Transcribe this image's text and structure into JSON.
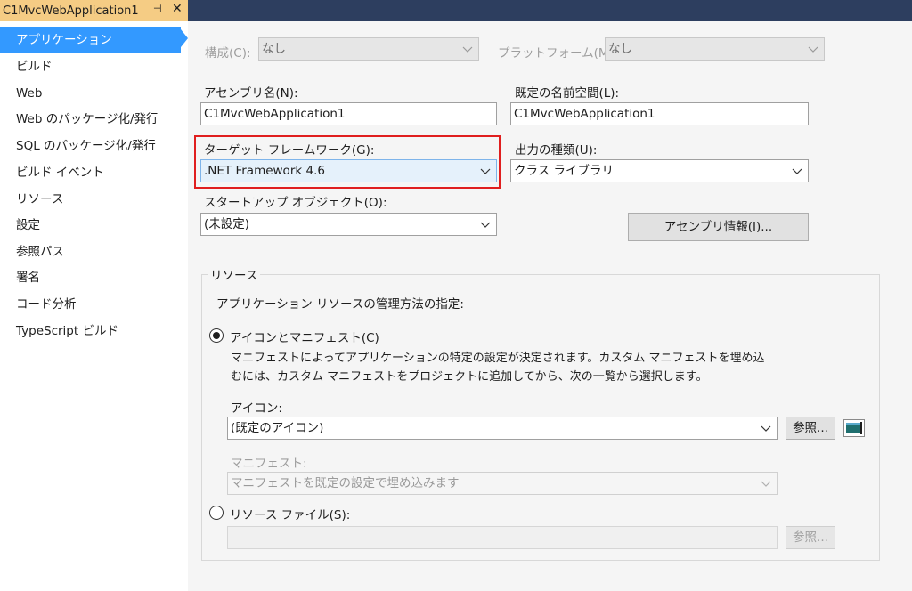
{
  "tab": {
    "title": "C1MvcWebApplication1",
    "pin_glyph": "⊣",
    "close_glyph": "✕"
  },
  "nav": {
    "items": [
      {
        "label": "アプリケーション"
      },
      {
        "label": "ビルド"
      },
      {
        "label": "Web"
      },
      {
        "label": "Web のパッケージ化/発行"
      },
      {
        "label": "SQL のパッケージ化/発行"
      },
      {
        "label": "ビルド イベント"
      },
      {
        "label": "リソース"
      },
      {
        "label": "設定"
      },
      {
        "label": "参照パス"
      },
      {
        "label": "署名"
      },
      {
        "label": "コード分析"
      },
      {
        "label": "TypeScript ビルド"
      }
    ],
    "selected_index": 0
  },
  "config": {
    "configuration_label": "構成(C):",
    "configuration_value": "なし",
    "platform_label": "プラットフォーム(M):",
    "platform_value": "なし"
  },
  "application": {
    "assembly_name_label": "アセンブリ名(N):",
    "assembly_name_value": "C1MvcWebApplication1",
    "default_namespace_label": "既定の名前空間(L):",
    "default_namespace_value": "C1MvcWebApplication1",
    "target_framework_label": "ターゲット フレームワーク(G):",
    "target_framework_value": ".NET Framework 4.6",
    "output_type_label": "出力の種類(U):",
    "output_type_value": "クラス ライブラリ",
    "startup_object_label": "スタートアップ オブジェクト(O):",
    "startup_object_value": "(未設定)",
    "assembly_info_button": "アセンブリ情報(I)..."
  },
  "resources": {
    "group_title": "リソース",
    "instruction": "アプリケーション リソースの管理方法の指定:",
    "icon_manifest_radio": "アイコンとマニフェスト(C)",
    "icon_manifest_desc": "マニフェストによってアプリケーションの特定の設定が決定されます。カスタム マニフェストを埋め込むには、カスタム マニフェストをプロジェクトに追加してから、次の一覧から選択します。",
    "icon_label": "アイコン:",
    "icon_value": "(既定のアイコン)",
    "browse_button": "参照...",
    "manifest_label": "マニフェスト:",
    "manifest_value": "マニフェストを既定の設定で埋め込みます",
    "resource_file_radio": "リソース ファイル(S):",
    "resource_file_value": "",
    "resource_browse_button": "参照..."
  }
}
